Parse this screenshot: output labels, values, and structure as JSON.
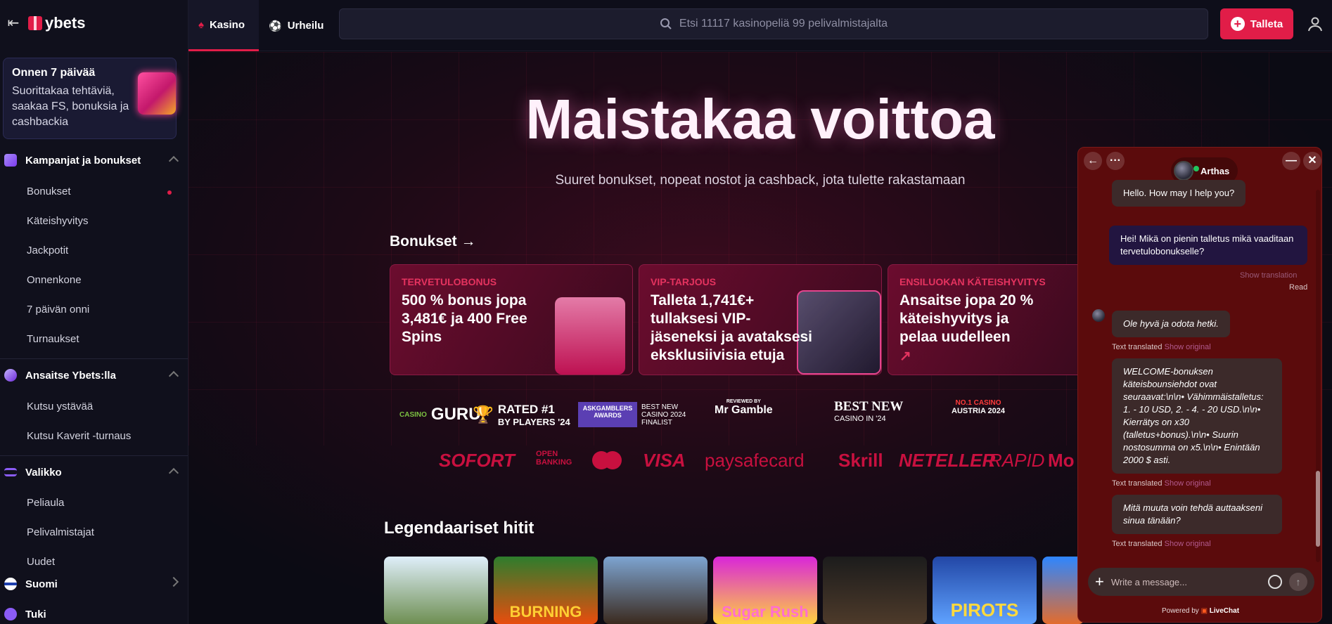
{
  "brand": {
    "name": "ybets"
  },
  "sidebar": {
    "promo": {
      "title": "Onnen 7 päivää",
      "text": "Suorittakaa tehtäviä, saakaa FS, bonuksia ja cashbackia"
    },
    "campaigns": {
      "title": "Kampanjat ja bonukset",
      "items": [
        "Bonukset",
        "Käteishyvitys",
        "Jackpotit",
        "Onnenkone",
        "7 päivän onni",
        "Turnaukset"
      ]
    },
    "earn": {
      "title": "Ansaitse Ybets:lla",
      "items": [
        "Kutsu ystävää",
        "Kutsu Kaverit -turnaus"
      ]
    },
    "menu": {
      "title": "Valikko",
      "items": [
        "Peliaula",
        "Pelivalmistajat",
        "Uudet"
      ]
    },
    "language": "Suomi",
    "support": "Tuki"
  },
  "topbar": {
    "tabs": [
      "Kasino",
      "Urheilu"
    ],
    "search_placeholder": "Etsi 11117 kasinopeliä 99 pelivalmistajalta",
    "deposit": "Talleta"
  },
  "hero": {
    "title": "Maistakaa voittoa",
    "subtitle": "Suuret bonukset, nopeat nostot ja cashback, jota tulette rakastamaan"
  },
  "bonuses": {
    "title": "Bonukset →",
    "cards": [
      {
        "tag": "TERVETULOBONUS",
        "text": "500 % bonus jopa 3,481€ ja 400 Free Spins"
      },
      {
        "tag": "VIP-TARJOUS",
        "text": "Talleta 1,741€+ tullaksesi VIP-jäseneksi ja avataksesi eksklusiivisia etuja"
      },
      {
        "tag": "ENSILUOKAN KÄTEISHYVITYS",
        "text": "Ansaitse jopa 20 % käteishyvitys ja pelaa uudelleen"
      }
    ]
  },
  "awards": [
    {
      "top": "CASINO",
      "main": "GURU"
    },
    {
      "top": "RATED #1",
      "main": "BY PLAYERS '24"
    },
    {
      "top": "ASKGAMBLERS AWARDS",
      "main": "BEST NEW CASINO 2024 FINALIST"
    },
    {
      "top": "REVIEWED BY",
      "main": "Mr Gamble"
    },
    {
      "top": "BEST NEW",
      "main": "CASINO IN '24"
    },
    {
      "top": "NO.1 CASINO",
      "main": "AUSTRIA 2024"
    }
  ],
  "payments": [
    "SOFORT",
    "OPEN BANKING",
    "VISA",
    "paysafecard",
    "Skrill",
    "NETELLER",
    "RAPID",
    "Mo"
  ],
  "games": {
    "title": "Legendaariset hitit",
    "tiles": [
      "",
      "BURNING",
      "",
      "Sugar Rush",
      "",
      "PIROTS",
      ""
    ]
  },
  "chat": {
    "agent": "Arthas",
    "messages": [
      {
        "from": "agent",
        "text": "Hello. How may I help you?"
      },
      {
        "from": "me",
        "text": "Hei! Mikä on pienin talletus mikä vaaditaan tervetulobonukselle?"
      },
      {
        "from": "agent",
        "text": "Ole hyvä ja odota hetki."
      },
      {
        "from": "agent",
        "text": "WELCOME-bonuksen käteisbounsiehdot ovat seuraavat:\\n\\n• Vähimmäistalletus: 1. - 10 USD, 2. - 4. - 20 USD.\\n\\n• Kierrätys on x30 (talletus+bonus).\\n\\n• Suurin nostosumma on x5.\\n\\n• Enintään 2000 $ asti."
      },
      {
        "from": "agent",
        "text": "Mitä muuta voin tehdä auttaakseni sinua tänään?"
      }
    ],
    "show_translation": "Show translation",
    "read": "Read",
    "text_translated": "Text translated",
    "show_original": "Show original",
    "input_placeholder": "Write a message...",
    "powered_prefix": "Powered by",
    "powered_brand": "LiveChat"
  },
  "colors": {
    "accent": "#e11d48",
    "chat_bg": "#5b0b0c"
  }
}
